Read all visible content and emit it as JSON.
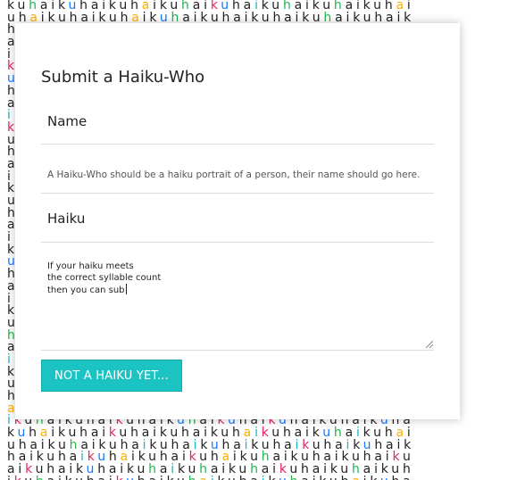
{
  "background": {
    "pattern_text": "kuhai",
    "colors": {
      "k": "#e4245e",
      "u": "#1677ff",
      "h": "#22b34f",
      "a": "#ffb000",
      "i": "#13b5c8",
      "default": "#222222"
    }
  },
  "form": {
    "title": "Submit a Haiku-Who",
    "name_label": "Name",
    "help_text": "A Haiku-Who should be a haiku portrait of a person, their name should go here.",
    "haiku_label": "Haiku",
    "haiku_value": "If your haiku meets\nthe correct syllable count\nthen you can sub",
    "submit_label": "NOT A HAIKU YET..."
  }
}
